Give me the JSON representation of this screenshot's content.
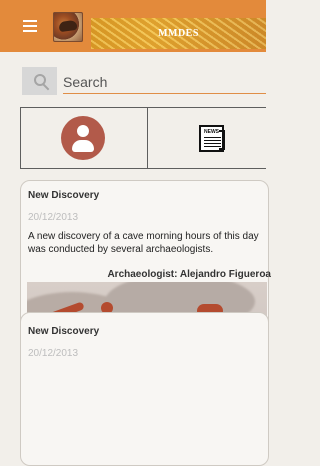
{
  "header": {
    "title": "MMDES",
    "menu_icon": "menu-icon",
    "logo_icon": "cave-painting-logo"
  },
  "search": {
    "placeholder": "Search",
    "value": "",
    "icon": "search-icon"
  },
  "tabs": [
    {
      "name": "profile",
      "icon": "user-circle-icon"
    },
    {
      "name": "news",
      "icon": "news-icon",
      "label": "NEWS"
    }
  ],
  "feed": [
    {
      "title": "New Discovery",
      "date": "20/12/2013",
      "body": "A new discovery of a cave morning hours of this day was conducted by several archaeologists.",
      "author": "Archaeologist: Alejandro Figueroa",
      "image_icon": "cave-painting-image"
    },
    {
      "title": "New Discovery",
      "date": "20/12/2013"
    }
  ],
  "colors": {
    "topbar": "#e38a3b",
    "profile_icon": "#b25a4a",
    "accent_line": "#e08e47",
    "background": "#f2efea"
  }
}
